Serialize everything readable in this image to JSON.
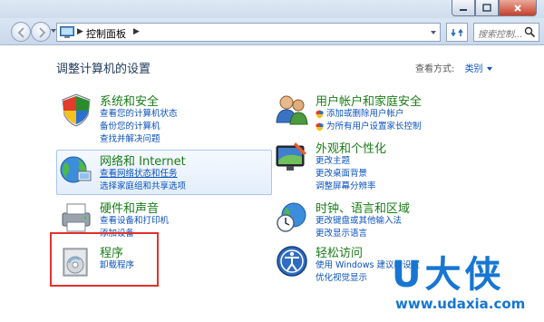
{
  "address": {
    "crumb": "控制面板",
    "search_placeholder": "搜索控制..."
  },
  "content": {
    "title": "调整计算机的设置",
    "view_by_label": "查看方式:",
    "view_by_value": "类别"
  },
  "categories": {
    "system": {
      "title": "系统和安全",
      "links": [
        "查看您的计算机状态",
        "备份您的计算机",
        "查找并解决问题"
      ]
    },
    "network": {
      "title": "网络和 Internet",
      "links": [
        "查看网络状态和任务",
        "选择家庭组和共享选项"
      ]
    },
    "hardware": {
      "title": "硬件和声音",
      "links": [
        "查看设备和打印机",
        "添加设备"
      ]
    },
    "programs": {
      "title": "程序",
      "links": [
        "卸载程序"
      ]
    },
    "users": {
      "title": "用户帐户和家庭安全",
      "links": [
        "添加或删除用户帐户",
        "为所有用户设置家长控制"
      ]
    },
    "appearance": {
      "title": "外观和个性化",
      "links": [
        "更改主题",
        "更改桌面背景",
        "调整屏幕分辨率"
      ]
    },
    "clock": {
      "title": "时钟、语言和区域",
      "links": [
        "更改键盘或其他输入法",
        "更改显示语言"
      ]
    },
    "ease": {
      "title": "轻松访问",
      "links": [
        "使用 Windows 建议的设置",
        "优化视觉显示"
      ]
    }
  },
  "watermark": {
    "brand": "U大侠",
    "url": "www.udaxia.com"
  },
  "colors": {
    "category_title": "#1a7d18",
    "link": "#0a52be",
    "highlight": "#e2312b",
    "watermark": "#1676d2"
  }
}
